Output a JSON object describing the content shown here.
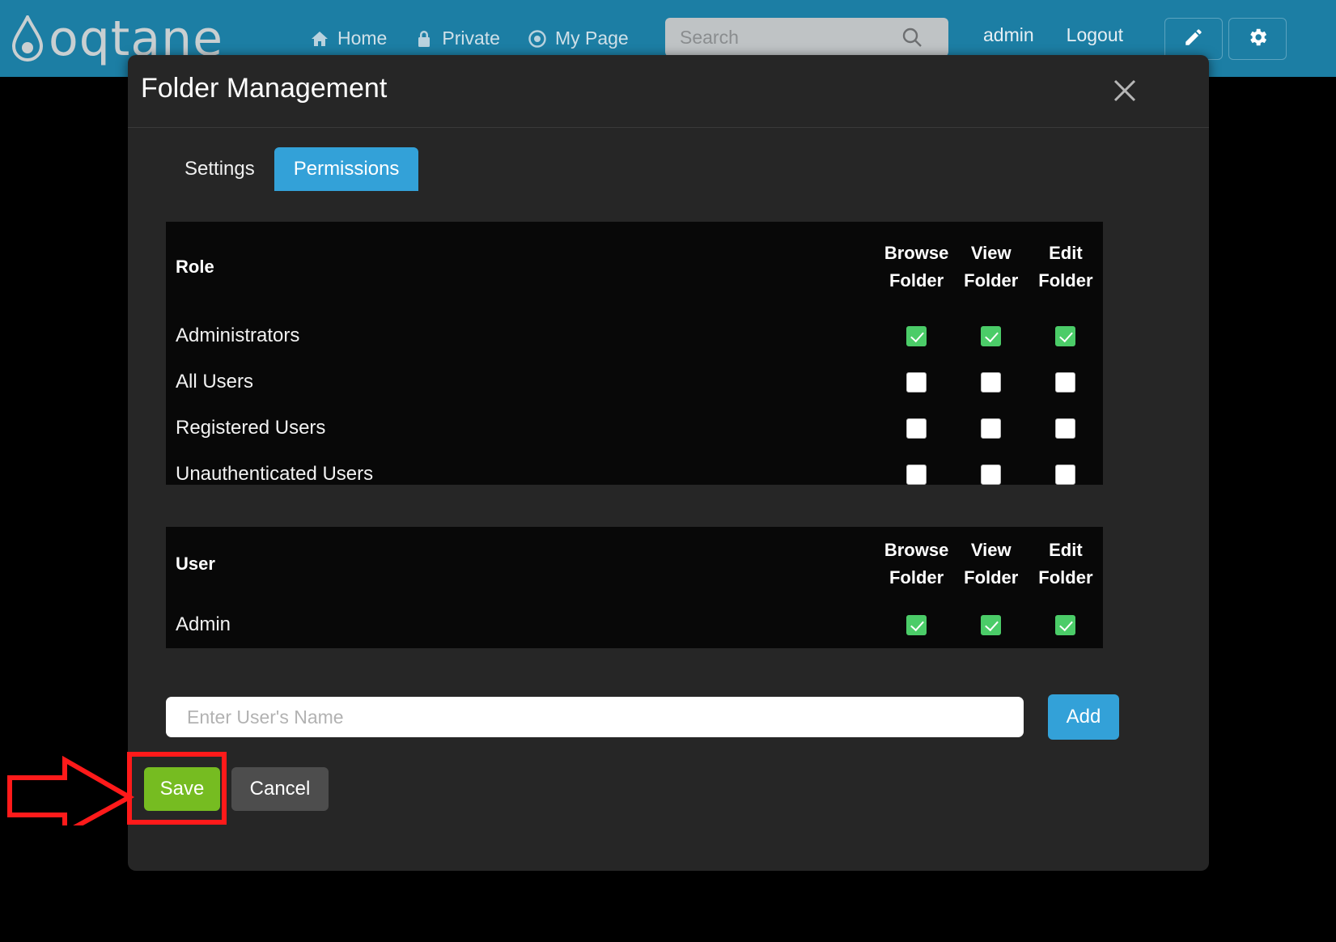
{
  "header": {
    "logo_text": "oqtane",
    "logo_icon": "water-drop-icon",
    "nav": [
      {
        "label": "Home",
        "icon": "home-icon"
      },
      {
        "label": "Private",
        "icon": "lock-icon"
      },
      {
        "label": "My Page",
        "icon": "target-icon"
      }
    ],
    "search": {
      "placeholder": "Search",
      "value": "",
      "icon": "search-icon"
    },
    "user": "admin",
    "logout": "Logout",
    "edit_button_icon": "pencil-icon",
    "settings_button_icon": "gear-icon",
    "background_color": "#1c7ea4"
  },
  "modal": {
    "title": "Folder Management",
    "close_icon": "close-icon",
    "tabs": [
      {
        "label": "Settings",
        "active": false
      },
      {
        "label": "Permissions",
        "active": true
      }
    ],
    "active_tab_color": "#33a1d8",
    "role_table": {
      "name_header": "Role",
      "columns": [
        "Browse Folder",
        "View Folder",
        "Edit Folder"
      ],
      "column_lines": [
        [
          "Browse",
          "Folder"
        ],
        [
          "View",
          "Folder"
        ],
        [
          "Edit",
          "Folder"
        ]
      ],
      "rows": [
        {
          "name": "Administrators",
          "checks": [
            true,
            true,
            true
          ]
        },
        {
          "name": "All Users",
          "checks": [
            false,
            false,
            false
          ]
        },
        {
          "name": "Registered Users",
          "checks": [
            false,
            false,
            false
          ]
        },
        {
          "name": "Unauthenticated Users",
          "checks": [
            false,
            false,
            false
          ]
        }
      ]
    },
    "user_table": {
      "name_header": "User",
      "columns": [
        "Browse Folder",
        "View Folder",
        "Edit Folder"
      ],
      "column_lines": [
        [
          "Browse",
          "Folder"
        ],
        [
          "View",
          "Folder"
        ],
        [
          "Edit",
          "Folder"
        ]
      ],
      "rows": [
        {
          "name": "Admin",
          "checks": [
            true,
            true,
            true
          ]
        }
      ]
    },
    "add_user": {
      "placeholder": "Enter User's Name",
      "value": "",
      "add_label": "Add"
    },
    "footer": {
      "save_label": "Save",
      "cancel_label": "Cancel",
      "save_color": "#76bc21",
      "cancel_color": "#4d4d4d"
    },
    "checkbox_on_color": "#4bcc68"
  },
  "annotation": {
    "color": "#ff1a1a",
    "arrow_icon": "right-arrow-annotation",
    "highlight_target": "save-button"
  }
}
